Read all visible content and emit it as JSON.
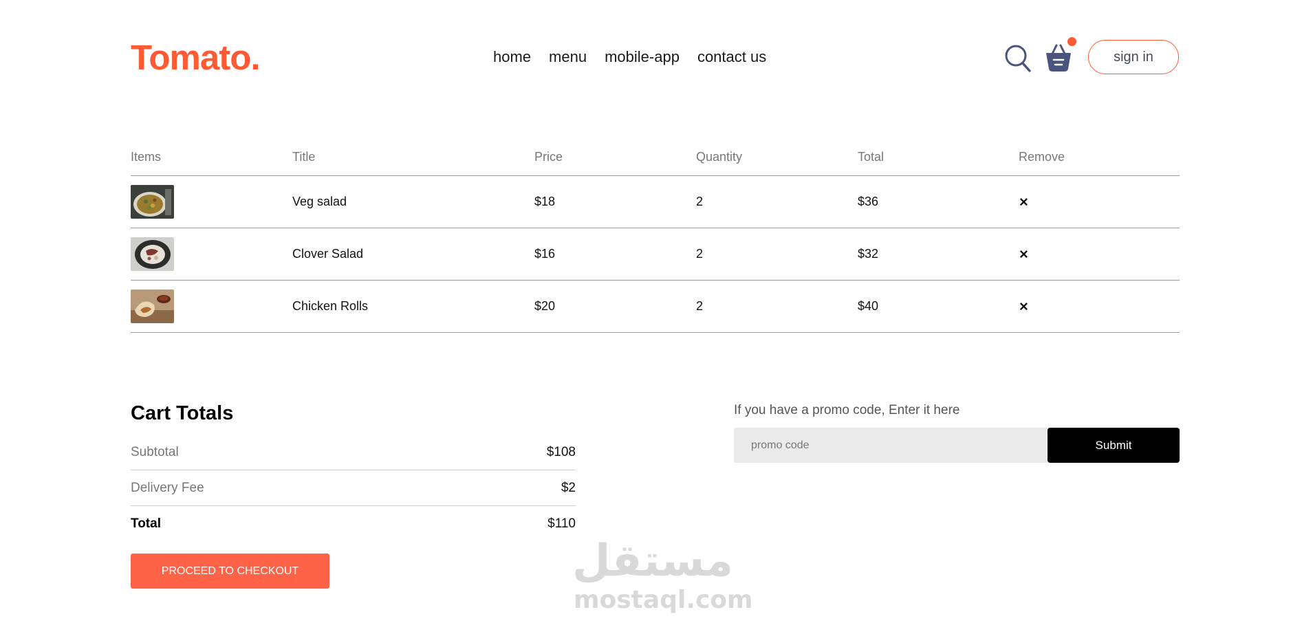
{
  "navbar": {
    "logo": "Tomato.",
    "links": [
      "home",
      "menu",
      "mobile-app",
      "contact us"
    ],
    "signin_label": "sign in",
    "search_icon": "search-icon",
    "basket_icon": "basket-icon",
    "accent": "#ff5a34"
  },
  "cart": {
    "headers": [
      "Items",
      "Title",
      "Price",
      "Quantity",
      "Total",
      "Remove"
    ],
    "rows": [
      {
        "title": "Veg salad",
        "price": "$18",
        "quantity": "2",
        "total": "$36",
        "remove": "×"
      },
      {
        "title": "Clover Salad",
        "price": "$16",
        "quantity": "2",
        "total": "$32",
        "remove": "×"
      },
      {
        "title": "Chicken Rolls",
        "price": "$20",
        "quantity": "2",
        "total": "$40",
        "remove": "×"
      }
    ]
  },
  "totals": {
    "title": "Cart Totals",
    "subtotal_label": "Subtotal",
    "subtotal_value": "$108",
    "delivery_label": "Delivery Fee",
    "delivery_value": "$2",
    "total_label": "Total",
    "total_value": "$110",
    "checkout_label": "PROCEED TO CHECKOUT"
  },
  "promo": {
    "text": "If you have a promo code, Enter it here",
    "placeholder": "promo code",
    "submit_label": "Submit"
  },
  "watermark": {
    "arabic": "مستقل",
    "latin": "mostaql.com"
  }
}
